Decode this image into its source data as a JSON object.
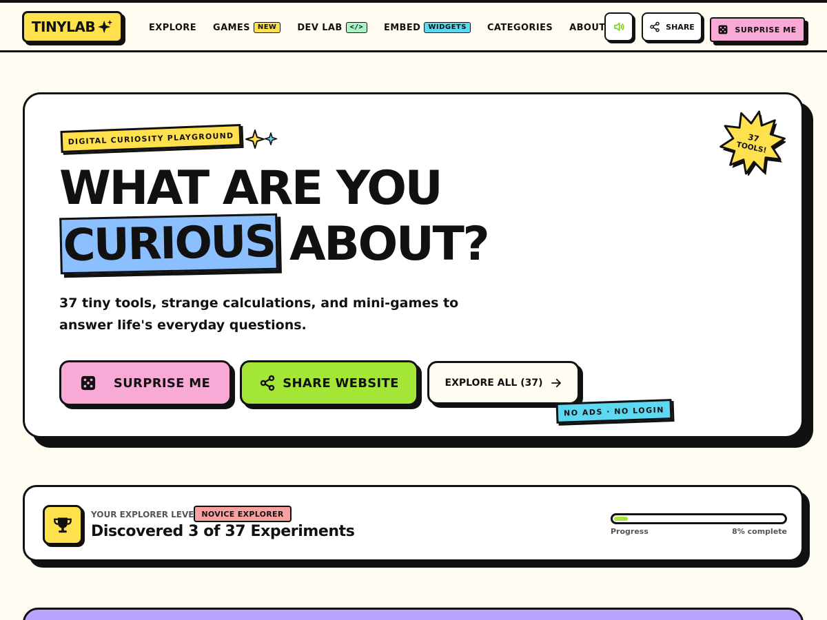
{
  "colors": {
    "yellow": "#ffe14d",
    "pink": "#f8a9d6",
    "green": "#a3e635",
    "blue": "#8cbfff",
    "cyan": "#5ed8f0",
    "purple": "#b9a4ff",
    "ink": "#111111",
    "cream": "#fffcf2"
  },
  "nav": {
    "logo": "TINYLAB",
    "logo_icon": "sparkle-icon",
    "links": [
      {
        "label": "EXPLORE"
      },
      {
        "label": "GAMES",
        "badge": "NEW"
      },
      {
        "label": "DEV LAB",
        "badge": "</>"
      },
      {
        "label": "EMBED",
        "badge": "WIDGETS"
      },
      {
        "label": "CATEGORIES"
      },
      {
        "label": "ABOUT"
      }
    ],
    "sound_icon": "speaker-icon",
    "share_label": "SHARE",
    "surprise_label": "SURPRISE ME"
  },
  "hero": {
    "tag": "DIGITAL CURIOSITY PLAYGROUND",
    "title_line1": "WHAT ARE YOU",
    "title_highlight": "CURIOUS",
    "title_line2_rest": "ABOUT?",
    "subtitle": "37 tiny tools, strange calculations, and mini-games to answer life's everyday questions.",
    "cta_surprise": "SURPRISE ME",
    "cta_share": "SHARE WEBSITE",
    "cta_explore": "EXPLORE ALL (37)",
    "tag_bottom": "NO ADS · NO LOGIN",
    "burst_line1": "37",
    "burst_line2": "TOOLS!"
  },
  "level": {
    "label": "YOUR EXPLORER LEVEL",
    "badge": "NOVICE EXPLORER",
    "title": "Discovered 3 of 37 Experiments",
    "progress_label": "Progress",
    "progress_text": "8% complete",
    "progress_fraction": 0.08
  }
}
